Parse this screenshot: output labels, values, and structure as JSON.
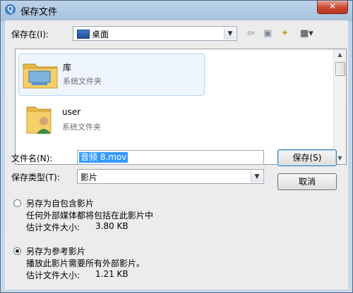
{
  "window": {
    "title": "保存文件",
    "close_glyph": "✕"
  },
  "location": {
    "label": "保存在(I):",
    "value": "桌面"
  },
  "toolbar": {
    "back_glyph": "⇦",
    "up_glyph": "▣",
    "newfolder_glyph": "✦",
    "view_glyph": "▦▾"
  },
  "files": [
    {
      "name": "库",
      "subtitle": "系统文件夹",
      "icon": "library-folder-icon"
    },
    {
      "name": "user",
      "subtitle": "系统文件夹",
      "icon": "user-folder-icon"
    }
  ],
  "form": {
    "filename_label": "文件名(N):",
    "filename_value": "音频 8.mov",
    "filetype_label": "保存类型(T):",
    "filetype_value": "影片"
  },
  "buttons": {
    "save": "保存(S)",
    "cancel": "取消"
  },
  "options": [
    {
      "label": "另存为自包含影片",
      "desc": "任何外部媒体都将包括在此影片中",
      "size_label": "估计文件大小:",
      "size_value": "3.80 KB",
      "selected": false
    },
    {
      "label": "另存为参考影片",
      "desc": "播放此影片需要所有外部影片。",
      "size_label": "估计文件大小:",
      "size_value": "1.21 KB",
      "selected": true
    }
  ],
  "colors": {
    "accent": "#3399ff",
    "title_bar": "#a6c0db",
    "close": "#c8452e"
  }
}
